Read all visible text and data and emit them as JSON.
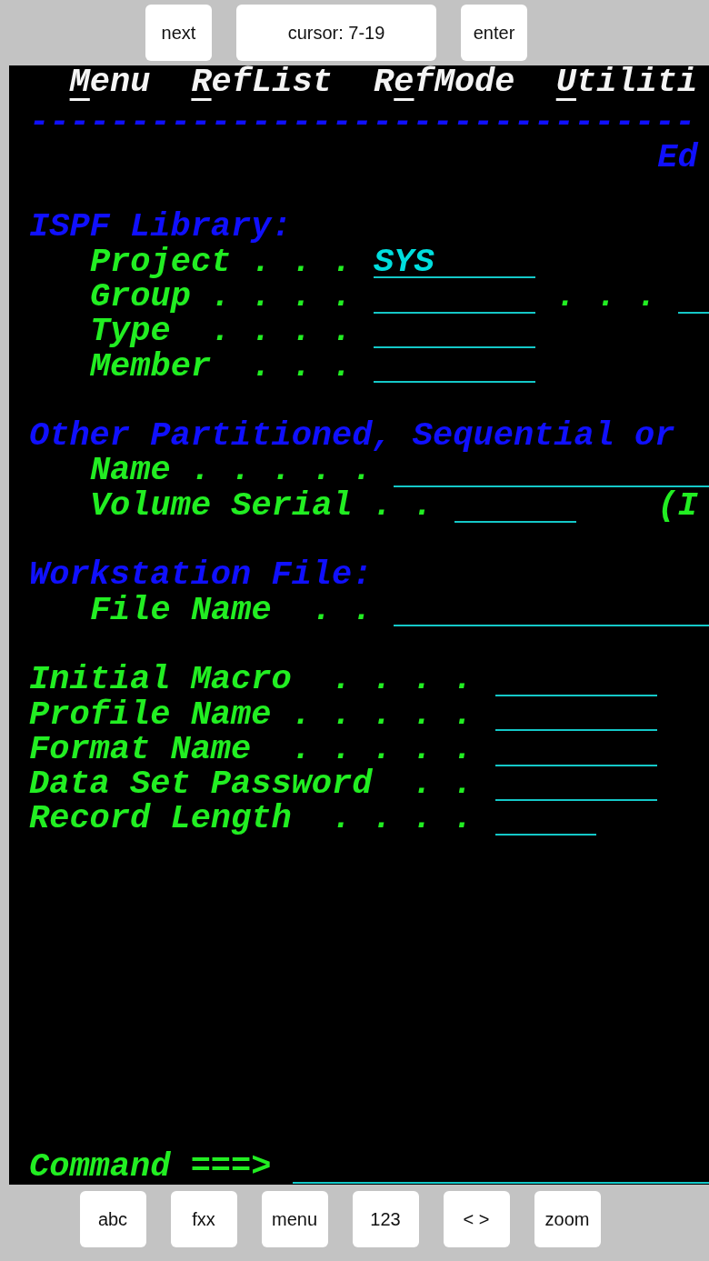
{
  "top_bar": [
    {
      "kind": "button",
      "label": "next"
    },
    {
      "kind": "readout",
      "label": "cursor: 7-19"
    },
    {
      "kind": "button",
      "label": "enter"
    }
  ],
  "terminal": {
    "menu_bar": [
      {
        "mnemonic": "M",
        "after": "enu"
      },
      {
        "mnemonic": "R",
        "after": "efList"
      },
      {
        "before": "R",
        "mnemonic": "e",
        "after": "fMode"
      },
      {
        "mnemonic": "U",
        "after": "tiliti"
      }
    ],
    "separator": "---------------------------------",
    "panel_title": "Ed",
    "lines": [
      {
        "segments": [
          {
            "kind": "heading",
            "text": "ISPF Library:"
          }
        ]
      },
      {
        "segments": [
          {
            "kind": "label",
            "text": "Project . . ."
          },
          {
            "kind": "field",
            "value": "SYS"
          }
        ]
      },
      {
        "segments": [
          {
            "kind": "label",
            "text": "Group . . . ."
          },
          {
            "kind": "field"
          },
          {
            "kind": "label",
            "text": ". . ."
          },
          {
            "kind": "field"
          }
        ]
      },
      {
        "segments": [
          {
            "kind": "label",
            "text": "Type  . . . ."
          },
          {
            "kind": "field"
          }
        ]
      },
      {
        "segments": [
          {
            "kind": "label",
            "text": "Member  . . ."
          },
          {
            "kind": "field"
          }
        ]
      },
      {
        "segments": [
          {
            "kind": "heading",
            "text": "Other Partitioned, Sequential or"
          }
        ]
      },
      {
        "segments": [
          {
            "kind": "label",
            "text": "Name . . . . ."
          },
          {
            "kind": "field"
          }
        ]
      },
      {
        "segments": [
          {
            "kind": "label",
            "text": "Volume Serial . ."
          },
          {
            "kind": "field"
          },
          {
            "kind": "label",
            "text": "(I"
          }
        ]
      },
      {
        "segments": [
          {
            "kind": "heading",
            "text": "Workstation File:"
          }
        ]
      },
      {
        "segments": [
          {
            "kind": "label",
            "text": "File Name  . ."
          },
          {
            "kind": "field"
          }
        ]
      },
      {
        "segments": [
          {
            "kind": "label",
            "text": "Initial Macro  . . . ."
          },
          {
            "kind": "field"
          }
        ]
      },
      {
        "segments": [
          {
            "kind": "label",
            "text": "Profile Name . . . . ."
          },
          {
            "kind": "field"
          }
        ]
      },
      {
        "segments": [
          {
            "kind": "label",
            "text": "Format Name  . . . . ."
          },
          {
            "kind": "field"
          }
        ]
      },
      {
        "segments": [
          {
            "kind": "label",
            "text": "Data Set Password  . ."
          },
          {
            "kind": "field"
          }
        ]
      },
      {
        "segments": [
          {
            "kind": "label",
            "text": "Record Length  . . . ."
          },
          {
            "kind": "field"
          }
        ]
      },
      {
        "segments": [
          {
            "kind": "label",
            "text": "Command ===>"
          },
          {
            "kind": "field"
          }
        ]
      }
    ]
  },
  "bottom_bar": [
    {
      "label": "abc"
    },
    {
      "label": "fxx"
    },
    {
      "label": "menu"
    },
    {
      "label": "123"
    },
    {
      "label": "< >"
    },
    {
      "label": "zoom"
    }
  ]
}
